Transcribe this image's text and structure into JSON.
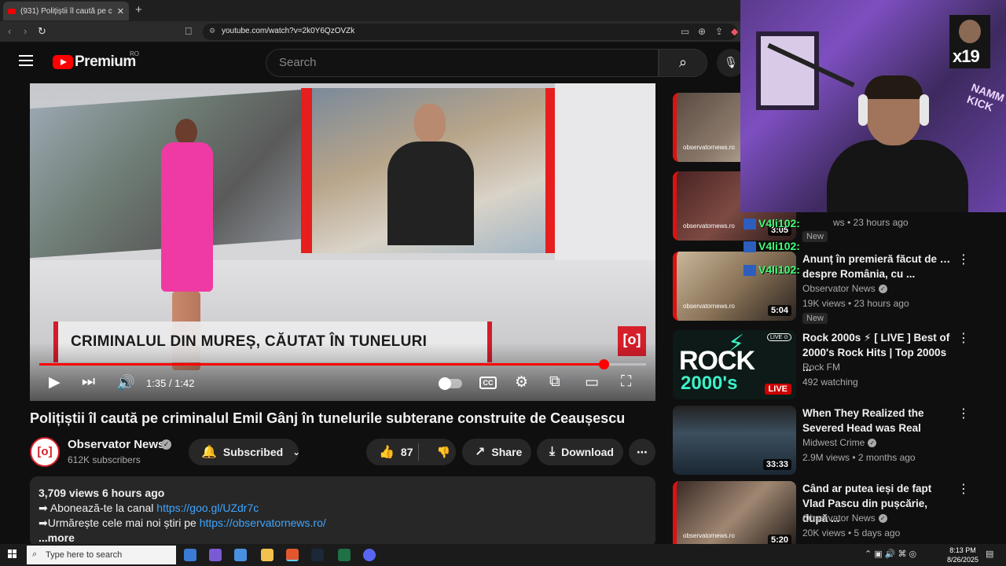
{
  "browser": {
    "tab_title": "(931) Polițiștii îl caută pe crimina",
    "new_tab": "+",
    "url": "youtube.com/watch?v=2k0Y6QzOVZk"
  },
  "header": {
    "logo_text": "Premium",
    "logo_region": "RO",
    "search_placeholder": "Search"
  },
  "player": {
    "lower_third": "CRIMINALUL DIN MUREȘ, CĂUTAT ÎN TUNELURI",
    "bug": "[o]",
    "time_current": "1:35",
    "time_total": "1:42",
    "time_display": "1:35 / 1:42",
    "progress": 0.93,
    "cc": "CC"
  },
  "video": {
    "title": "Polițiștii îl caută pe criminalul Emil Gânj în tunelurile subterane construite de Ceaușescu",
    "channel": "Observator News",
    "subscribers": "612K subscribers",
    "subscribed_label": "Subscribed",
    "likes": "87",
    "share_label": "Share",
    "download_label": "Download"
  },
  "description": {
    "meta": "3,709 views  6 hours ago",
    "line1_prefix": "➡ Abonează-te la canal ",
    "line1_link": "https://goo.gl/UZdr7c",
    "line2_prefix": "➡Urmărește cele mai noi știri pe ",
    "line2_link": "https://observatornews.ro/",
    "more": "...more"
  },
  "sidebar": [
    {
      "thumb_label": "observatornews.ro"
    },
    {
      "thumb_label": "observatornews.ro",
      "duration": "3:05",
      "meta": "ws • 23 hours ago",
      "badge": "New"
    },
    {
      "title": "Anunț în premieră făcut de … despre România, cu ...",
      "channel": "Observator News",
      "meta": "19K views • 23 hours ago",
      "badge": "New",
      "duration": "5:04",
      "thumb_label": "observatornews.ro"
    },
    {
      "title": "Rock 2000s ⚡ [ LIVE ] Best of 2000's Rock Hits | Top 2000s ...",
      "channel": "Rock FM",
      "meta": "492 watching",
      "live": "LIVE",
      "thumb_big": "ROCK",
      "thumb_big2": "2000's",
      "thumb_live": "LIVE ⊙"
    },
    {
      "title": "When They Realized the Severed Head was Real",
      "channel": "Midwest Crime",
      "meta": "2.9M views • 2 months ago",
      "duration": "33:33"
    },
    {
      "title": "Când ar putea ieși de fapt Vlad Pascu din pușcărie, după ...",
      "channel": "Observator News",
      "meta": "20K views • 5 days ago",
      "duration": "5:20",
      "thumb_label": "observatornews.ro"
    }
  ],
  "overlay": {
    "x19": "x19",
    "chat": [
      "V4li102:",
      "V4li102:",
      "V4li102:"
    ],
    "neon": "NAMM X KICK"
  },
  "taskbar": {
    "search_placeholder": "Type here to search",
    "time": "8:13 PM",
    "date": "8/26/2025"
  },
  "colors": {
    "accent": "#ff0000",
    "link": "#3ea6ff",
    "chat": "#41ff78",
    "bg": "#0f0f0f"
  }
}
